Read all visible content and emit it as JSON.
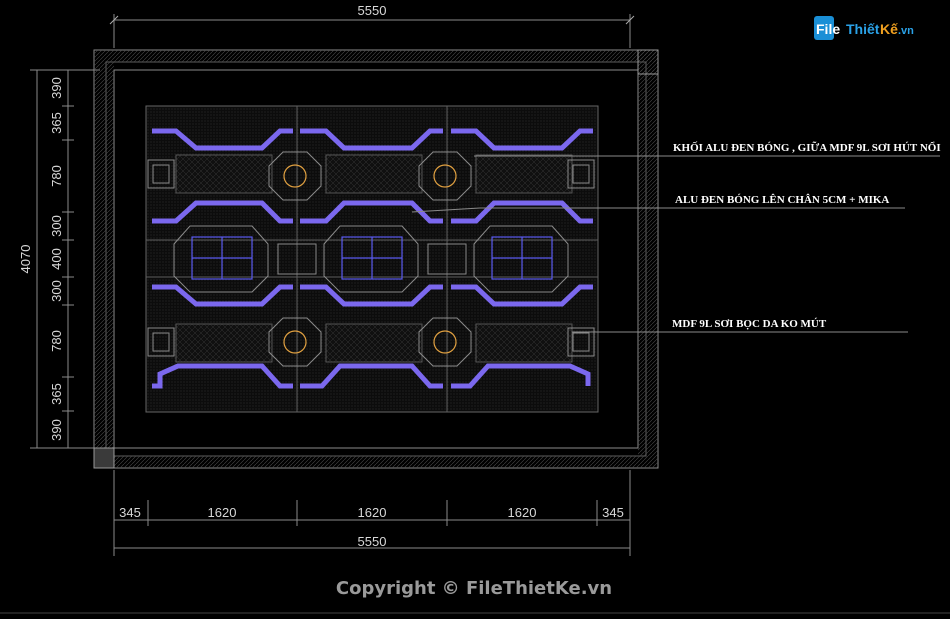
{
  "dimensions": {
    "top_total": "5550",
    "bottom_total": "5550",
    "bottom_segments": [
      "345",
      "1620",
      "1620",
      "1620",
      "345"
    ],
    "left_total": "4070",
    "left_segments": [
      "390",
      "365",
      "780",
      "300",
      "400",
      "300",
      "780",
      "365",
      "390"
    ]
  },
  "annotations": [
    "KHỐI ALU ĐEN BÓNG , GIỮA MDF 9L SƠI HÚT NỔI",
    "ALU ĐEN BÓNG LÊN CHÂN 5CM + MIKA",
    "MDF 9L SƠI BỌC DA KO MÚT"
  ],
  "watermark": "Copyright © FileThietKe.vn",
  "logo": {
    "text": "FileThietKe.vn",
    "letters": [
      "File",
      "Thiết",
      "Kế",
      ".vn"
    ]
  },
  "colors": {
    "accent_purple": "#7b68ee",
    "blue_panel": "#5a5af0",
    "orange_circle": "#e0a040",
    "line_gray": "#8a8a8a"
  }
}
